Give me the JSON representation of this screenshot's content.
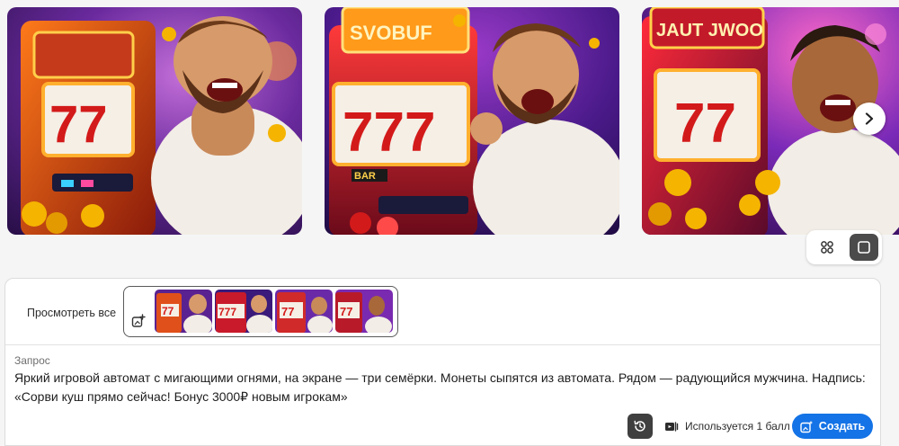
{
  "gallery": {
    "images": [
      {
        "icon": "slot-machine-man-image-1"
      },
      {
        "icon": "slot-machine-man-image-2",
        "sign_text": "SVOBUF"
      },
      {
        "icon": "slot-machine-man-image-3",
        "sign_text": "JAUT JWOO"
      }
    ],
    "next_icon": "chevron-right-icon",
    "view_toggle": {
      "grid_icon": "grid-view-icon",
      "single_icon": "single-view-icon"
    }
  },
  "panel": {
    "view_all_label": "Просмотреть все",
    "upload_icon": "upload-image-icon",
    "thumbnails": [
      {
        "icon": "thumbnail-1"
      },
      {
        "icon": "thumbnail-2"
      },
      {
        "icon": "thumbnail-3"
      },
      {
        "icon": "thumbnail-4"
      }
    ],
    "prompt_label": "Запрос",
    "prompt_text": "Яркий игровой автомат с мигающими огнями, на экране — три семёрки. Монеты сыпятся из автомата. Рядом — радующийся мужчина. Надпись: «Сорви куш прямо сейчас! Бонус 3000₽ новым игрокам»",
    "history_icon": "history-icon",
    "credits_text": "Используется 1 балл",
    "credits_icon": "credits-icon",
    "create_label": "Создать",
    "create_icon": "generate-icon"
  },
  "colors": {
    "accent": "#1473e6",
    "dark_button": "#3f3f3f"
  }
}
